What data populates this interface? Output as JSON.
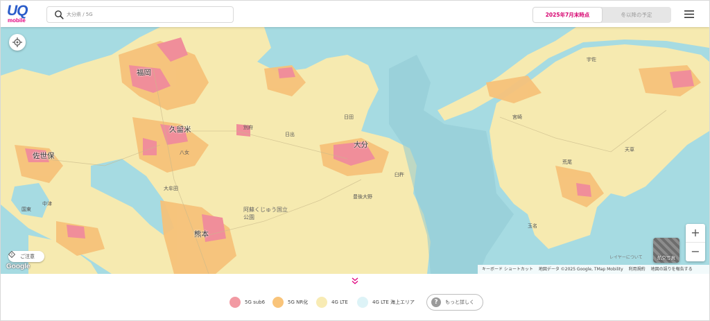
{
  "brand": {
    "logo_main": "UQ",
    "logo_sub": "mobile",
    "accent": "#d6006e",
    "logo_blue": "#2a5cc9"
  },
  "search": {
    "placeholder": "大分県 / 5G"
  },
  "toggle": {
    "active": "2025年7月末時点",
    "inactive": "冬以降の予定"
  },
  "map": {
    "labels": [
      "福岡",
      "久留米",
      "大分",
      "熊本",
      "佐世保",
      "阿蘇くじゅう国立公園"
    ],
    "small_labels": [
      "日田",
      "日出",
      "豊後大野",
      "臼杵",
      "宮崎",
      "八女",
      "大牟田",
      "荒尾",
      "玉名",
      "天草",
      "宇佐",
      "中津",
      "国東",
      "別府",
      "由布",
      "竹田",
      "佐伯",
      "嬉野",
      "唐津",
      "伊万里",
      "武雄",
      "鹿島",
      "島原",
      "雲仙",
      "宇土",
      "八代",
      "南阿蘇",
      "高森",
      "山都",
      "五島",
      "松浦",
      "大村",
      "諫早",
      "平戸",
      "西海",
      "長洲",
      "北九州",
      "行橋",
      "豊前",
      "田川",
      "飯塚",
      "宗像",
      "朝倉",
      "八幡",
      "うきは",
      "小国",
      "玖珠",
      "九重",
      "杵築",
      "佐賀",
      "小城",
      "多久",
      "鳥栖",
      "神埼",
      "みやま",
      "柳川",
      "大川",
      "筑後",
      "広川",
      "合志",
      "菊池",
      "山鹿",
      "和水",
      "南関",
      "大津",
      "益城",
      "御船",
      "甲佐",
      "美里",
      "氷川",
      "宇城",
      "上天草",
      "芦北",
      "水俣",
      "人吉",
      "四万十",
      "宿毛",
      "土佐清水",
      "黒潮",
      "大月",
      "愛南",
      "宇和島",
      "西予",
      "八幡浜",
      "大洲",
      "内子",
      "伊予",
      "松山",
      "東温",
      "今治",
      "西条",
      "新居浜",
      "四国中央",
      "観音寺",
      "三豊",
      "善通寺",
      "丸亀",
      "坂出",
      "高松",
      "さぬき",
      "東かがわ",
      "鳴門",
      "徳島",
      "小松島",
      "阿南",
      "美波",
      "海陽",
      "三好",
      "美馬",
      "吉野川",
      "阿波",
      "つるぎ",
      "上勝",
      "神山",
      "那賀",
      "牟岐",
      "安芸",
      "室戸",
      "香南",
      "南国",
      "高知",
      "土佐",
      "いの",
      "須崎",
      "中土佐",
      "四万十町",
      "梼原",
      "津野",
      "佐川",
      "越知",
      "仁淀川",
      "日高",
      "大豊",
      "本山",
      "土佐町",
      "大川村",
      "北川",
      "馬路",
      "安田",
      "田野",
      "奈半利",
      "芸西",
      "香美",
      "佐田岬",
      "伊方",
      "八幡浜港",
      "松野",
      "鬼北",
      "内海",
      "久万高原",
      "砥部",
      "松前"
    ],
    "guide_label": "ご注意",
    "google": "Google",
    "zoom_in": "+",
    "zoom_out": "−",
    "aerial": "航空写真",
    "layer_note": "レイヤーについて",
    "attribution": {
      "keyboard": "キーボード ショートカット",
      "data": "地図データ ©2025 Google, TMap Mobility",
      "terms": "利用規約",
      "report": "地図の誤りを報告する"
    }
  },
  "legend": {
    "items": [
      {
        "label": "5G sub6",
        "color": "#f29aa3"
      },
      {
        "label": "5G NR化",
        "color": "#f9c47a"
      },
      {
        "label": "4G LTE",
        "color": "#f8ebb4"
      },
      {
        "label": "4G LTE 海上エリア",
        "color": "#ddf3f7"
      }
    ],
    "more": "もっと詳しく"
  }
}
